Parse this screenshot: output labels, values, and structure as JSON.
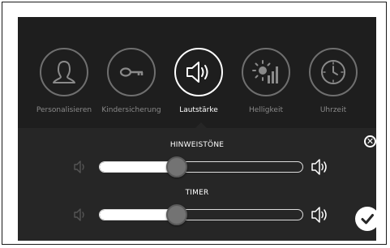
{
  "categories": [
    {
      "label": "Personalisieren",
      "icon": "person-icon",
      "active": false
    },
    {
      "label": "Kindersicherung",
      "icon": "key-icon",
      "active": false
    },
    {
      "label": "Lautstärke",
      "icon": "speaker-icon",
      "active": true
    },
    {
      "label": "Helligkeit",
      "icon": "brightness-icon",
      "active": false
    },
    {
      "label": "Uhrzeit",
      "icon": "clock-icon",
      "active": false
    }
  ],
  "settings": [
    {
      "title": "HINWEISTÖNE",
      "level": 0.38
    },
    {
      "title": "TIMER",
      "level": 0.38
    }
  ],
  "colors": {
    "background": "#1e1e1e",
    "panel": "#262626",
    "accent": "#ffffff",
    "inactive": "#6f6f6f"
  }
}
